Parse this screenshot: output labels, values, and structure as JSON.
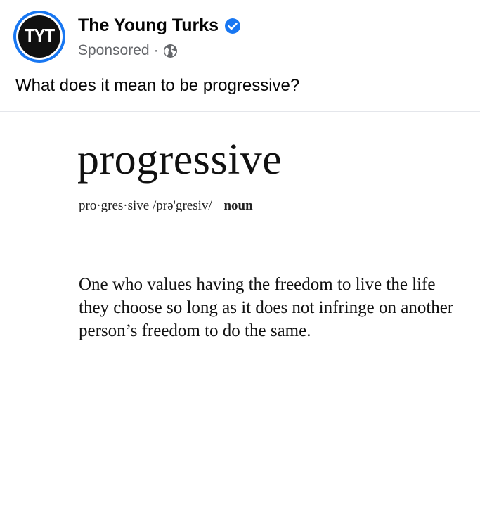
{
  "post": {
    "avatar_text": "TYT",
    "page_name": "The Young Turks",
    "verified": true,
    "meta": {
      "sponsored_label": "Sponsored",
      "separator": "·",
      "audience_icon": "globe-icon"
    },
    "caption": "What does it mean to be progressive?"
  },
  "card": {
    "word": "progressive",
    "syllables": "pro·gres·sive",
    "pronunciation": "/prə'gresiv/",
    "part_of_speech": "noun",
    "definition": "One who values having the freedom to live the life they choose so long as it does not infringe on another person’s freedom to do the same."
  },
  "colors": {
    "accent": "#1877f2",
    "secondary_text": "#65676b",
    "primary_text": "#050505"
  }
}
